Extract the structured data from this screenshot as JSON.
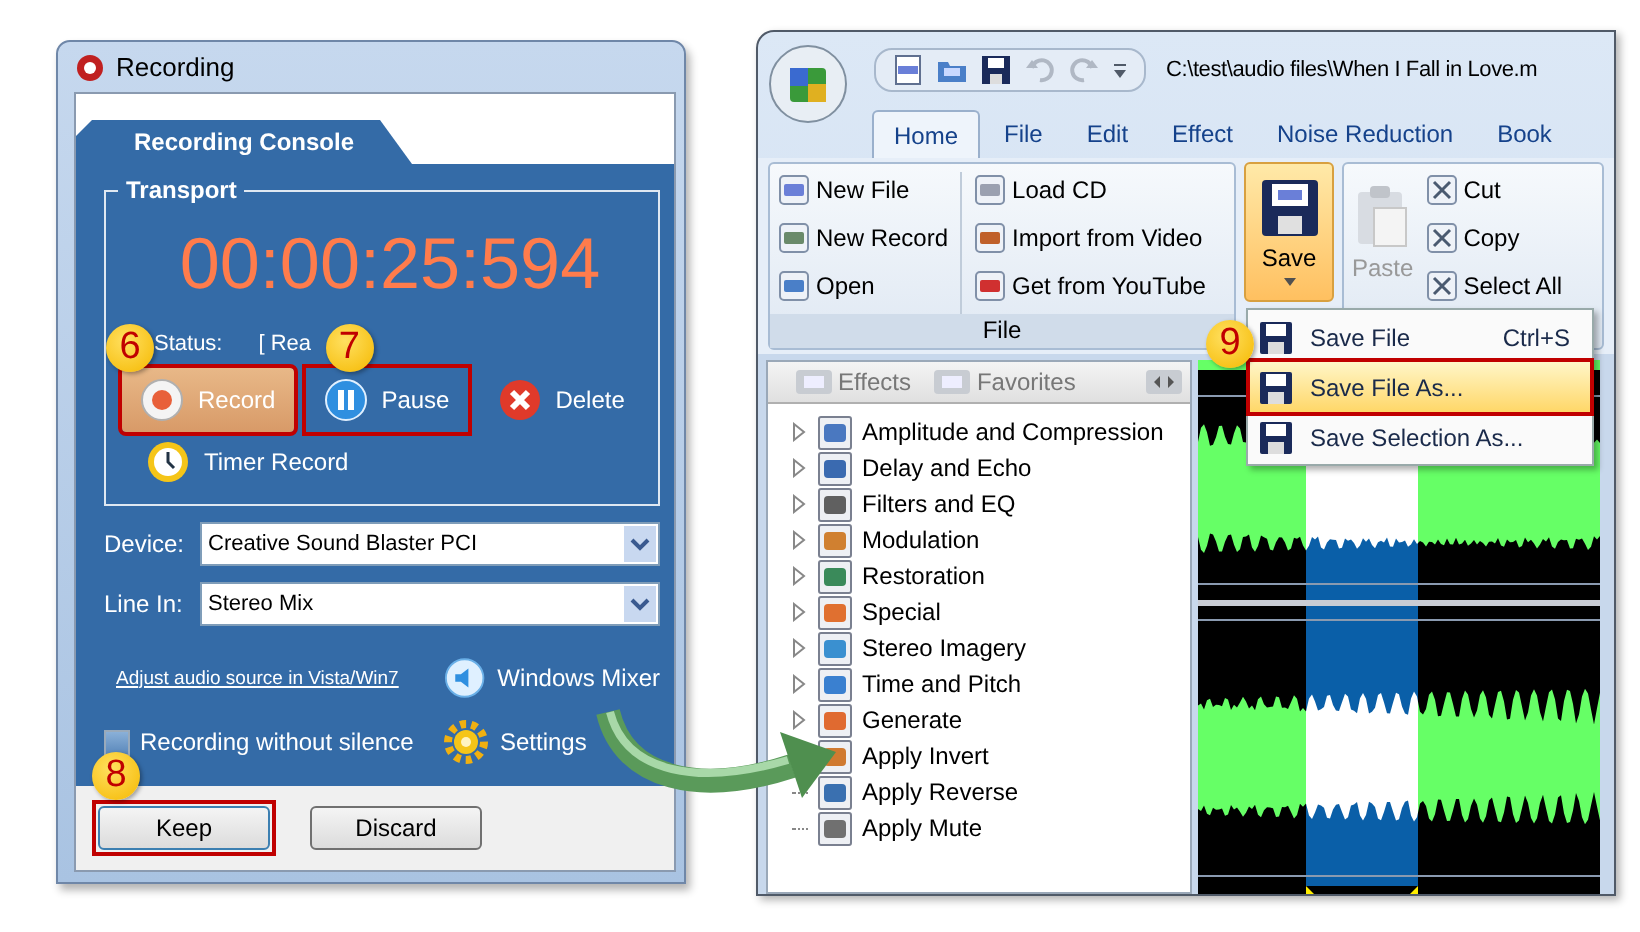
{
  "recording_window": {
    "title": "Recording",
    "tab": "Recording Console",
    "group": "Transport",
    "timer": "00:00:25:594",
    "status_label": "Status:",
    "status_value": "[ Rea",
    "buttons": [
      {
        "label": "Record",
        "kind": "record",
        "selected": true,
        "callout": "6"
      },
      {
        "label": "Pause",
        "kind": "pause",
        "selected": false,
        "callout": "7"
      },
      {
        "label": "Delete",
        "kind": "delete",
        "selected": false
      }
    ],
    "timer_record": "Timer Record",
    "fields": [
      {
        "label": "Device:",
        "value": "Creative Sound Blaster PCI"
      },
      {
        "label": "Line In:",
        "value": "Stereo Mix"
      }
    ],
    "link": "Adjust audio source in Vista/Win7",
    "mixer": "Windows Mixer",
    "checkbox": {
      "label": "Recording without silence",
      "checked": false
    },
    "settings": "Settings",
    "footer_buttons": [
      {
        "label": "Keep",
        "callout": "8"
      },
      {
        "label": "Discard"
      }
    ]
  },
  "editor_window": {
    "path": "C:\\test\\audio files\\When I Fall in Love.m",
    "tabs": [
      {
        "label": "Home",
        "selected": true
      },
      {
        "label": "File",
        "selected": false
      },
      {
        "label": "Edit",
        "selected": false
      },
      {
        "label": "Effect",
        "selected": false
      },
      {
        "label": "Noise Reduction",
        "selected": false
      },
      {
        "label": "Book",
        "selected": false
      }
    ],
    "file_group": {
      "columns": [
        [
          "New File",
          "New Record",
          "Open"
        ],
        [
          "Load CD",
          "Import from Video",
          "Get from YouTube"
        ]
      ],
      "label": "File"
    },
    "save": "Save",
    "clipboard": [
      {
        "label": "Paste",
        "disabled": true
      },
      {
        "label": "Cut",
        "disabled": false
      },
      {
        "label": "Copy",
        "disabled": false
      },
      {
        "label": "Select All",
        "disabled": false
      }
    ],
    "save_menu": [
      {
        "label": "Save File",
        "shortcut": "Ctrl+S",
        "selected": false
      },
      {
        "label": "Save File As...",
        "selected": true,
        "callout": "9"
      },
      {
        "label": "Save Selection As...",
        "selected": false
      }
    ],
    "panel_tabs": [
      "Effects",
      "Favorites"
    ],
    "effects": [
      {
        "label": "Amplitude and Compression",
        "kind": "group"
      },
      {
        "label": "Delay and Echo",
        "kind": "group"
      },
      {
        "label": "Filters and EQ",
        "kind": "group"
      },
      {
        "label": "Modulation",
        "kind": "group"
      },
      {
        "label": "Restoration",
        "kind": "group"
      },
      {
        "label": "Special",
        "kind": "group"
      },
      {
        "label": "Stereo Imagery",
        "kind": "group"
      },
      {
        "label": "Time and Pitch",
        "kind": "group"
      },
      {
        "label": "Generate",
        "kind": "group"
      },
      {
        "label": "Apply Invert",
        "kind": "action"
      },
      {
        "label": "Apply Reverse",
        "kind": "action"
      },
      {
        "label": "Apply Mute",
        "kind": "action"
      }
    ]
  }
}
